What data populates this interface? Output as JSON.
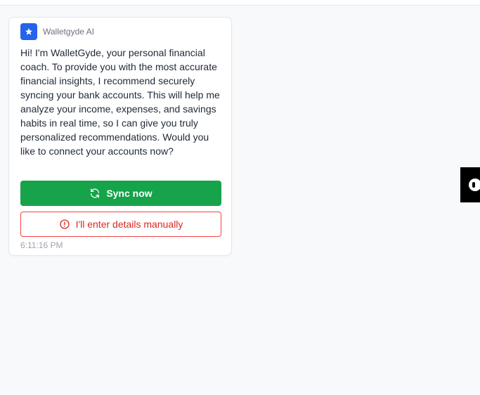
{
  "chat": {
    "sender": "Walletgyde AI",
    "message": "Hi! I'm WalletGyde, your personal financial coach. To provide you with the most accurate financial insights, I recommend securely syncing your bank accounts. This will help me analyze your income, expenses, and savings habits in real time, so I can give you truly personalized recommendations. Would you like to connect your accounts now?",
    "sync_label": "Sync now",
    "manual_label": "I'll enter details manually",
    "timestamp": "6:11:16 PM"
  },
  "icons": {
    "avatar": "star-icon",
    "sync": "refresh-icon",
    "manual": "alert-circle-icon",
    "side_widget": "chat-widget-icon"
  },
  "colors": {
    "avatar_bg": "#2563eb",
    "sync_bg": "#16a34a",
    "manual_border": "#ef4444",
    "manual_text": "#dc2626"
  }
}
